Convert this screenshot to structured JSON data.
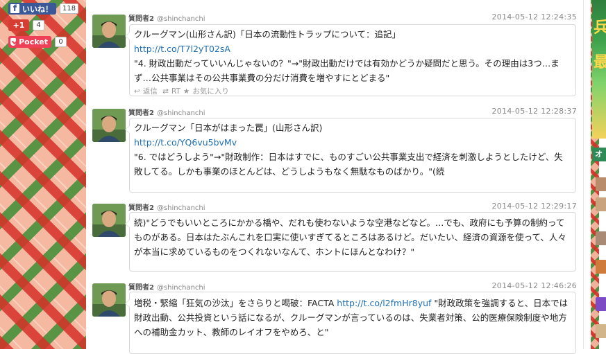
{
  "share": {
    "facebook": {
      "label": "いいね！",
      "count": "118"
    },
    "googleplus": {
      "label": "+1",
      "count": "4"
    },
    "pocket": {
      "label": "Pocket",
      "count": "0"
    }
  },
  "tweets": [
    {
      "user": "質問者2",
      "handle": "@shinchanchi",
      "time": "2014-05-12 12:24:35",
      "line1": "クルーグマン(山形さん訳)「日本の流動性トラップについて：追記」",
      "link": "http://t.co/T7l2yT02sA",
      "rest": "\"4. 財政出動だっていいんじゃないの？\"→\"財政出動だけでは有効かどうか疑問だと思う。その理由は3つ…まず…公共事業はその公共事業費の分だけ消費を増やすにとどまる\"",
      "actions": {
        "reply": "返信",
        "rt": "RT",
        "fav": "お気に入り"
      }
    },
    {
      "user": "質問者2",
      "handle": "@shinchanchi",
      "time": "2014-05-12 12:28:37",
      "line1": "クルーグマン「日本がはまった罠」(山形さん訳)",
      "link": "http://t.co/YQ6vu5bvMv",
      "rest": "\"6. ではどうしよう\"→\"財政制作：日本はすでに、ものすごい公共事業支出で経済を刺激しようとしたけど、失敗してる。しかも事業のほとんどは、どうしようもなく無駄なものばかり。\"(続"
    },
    {
      "user": "質問者2",
      "handle": "@shinchanchi",
      "time": "2014-05-12 12:29:17",
      "text": "続)\"どうでもいいところにかかる橋や、だれも使わないような空港などなど。…でも、政府にも予算の制約ってものがある。日本はたぶんこれを口実に使いすぎてるところはあるけど。だいたい、経済の資源を使って、人々が本当に求めているものをつくれないなんて、ホントにほんとなわけ？\""
    },
    {
      "user": "質問者2",
      "handle": "@shinchanchi",
      "time": "2014-05-12 12:46:26",
      "pre": "増税・緊縮「狂気の沙汰」をさらりと喝破：FACTA ",
      "link": "http://t.co/l2fmHr8yuf",
      "rest": " \"財政政策を強調すると、日本では財政出動、公共投資という話になるが、クルーグマンが言っているのは、失業者対策、公的医療保険制度や地方への補助金カット、教師のレイオフをやめろ、と\""
    }
  ],
  "sidebar": {
    "banner_chars": [
      "兵",
      "最"
    ],
    "tab_label": "オ"
  }
}
